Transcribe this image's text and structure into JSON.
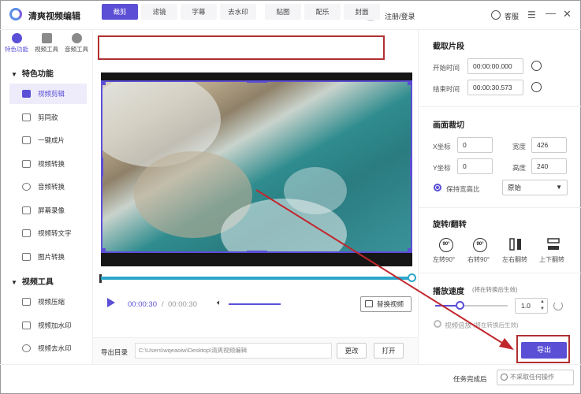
{
  "app": {
    "title": "清爽视频编辑",
    "login": "注册/登录",
    "support": "客服"
  },
  "top_icons": [
    {
      "label": "特色功能"
    },
    {
      "label": "视频工具"
    },
    {
      "label": "音频工具"
    }
  ],
  "sections": {
    "featured": "特色功能",
    "video_tools": "视频工具"
  },
  "featured_items": [
    {
      "label": "视频剪辑"
    },
    {
      "label": "剪同款"
    },
    {
      "label": "一键成片"
    },
    {
      "label": "视频转换"
    },
    {
      "label": "音频转换"
    },
    {
      "label": "屏幕录像"
    },
    {
      "label": "视频转文字"
    },
    {
      "label": "图片转换"
    }
  ],
  "video_tool_items": [
    {
      "label": "视频压缩"
    },
    {
      "label": "视频加水印"
    },
    {
      "label": "视频去水印"
    }
  ],
  "tabs": [
    "裁剪",
    "滤镜",
    "字幕",
    "去水印",
    "贴图",
    "配乐",
    "封面"
  ],
  "player": {
    "current": "00:00:30",
    "separator": "/",
    "total": "00:00:30",
    "replace": "替换视频"
  },
  "output": {
    "label": "导出目录",
    "path": "C:\\Users\\wqeaoiw\\Desktop\\清爽视频编辑",
    "change": "更改",
    "open": "打开"
  },
  "clip": {
    "title": "截取片段",
    "start_label": "开始时间",
    "start": "00:00:00.000",
    "end_label": "结束时间",
    "end": "00:00:30.573"
  },
  "crop": {
    "title": "画面裁切",
    "x_label": "X坐标",
    "x": "0",
    "y_label": "Y坐标",
    "y": "0",
    "w_label": "宽度",
    "w": "426",
    "h_label": "高度",
    "h": "240",
    "keep_ratio": "保持宽高比",
    "ratio": "原始"
  },
  "rotate": {
    "title": "旋转/翻转",
    "left": "左转90°",
    "right": "右转90°",
    "hflip": "左右翻转",
    "vflip": "上下翻转",
    "left_icon": "90°",
    "right_icon": "90°"
  },
  "speed": {
    "title": "播放速度",
    "note": "(将在转换后生效)",
    "value": "1.0",
    "fade": "视频倍放",
    "fade_note": "(将在转换后生效)"
  },
  "export": {
    "label": "导出"
  },
  "status": {
    "task_label": "任务完成后",
    "task_value": "不采取任何操作"
  },
  "colors": {
    "accent": "#5b4fd6",
    "highlight": "#b03030",
    "timeline": "#2ba6c9"
  }
}
